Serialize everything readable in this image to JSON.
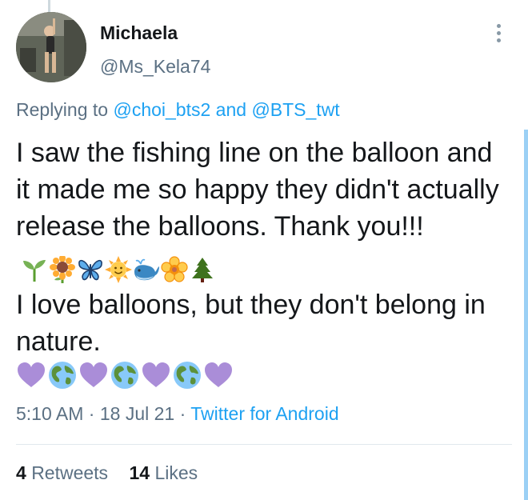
{
  "author": {
    "display_name": "Michaela",
    "handle": "@Ms_Kela74"
  },
  "reply": {
    "prefix": "Replying to",
    "user1": "@choi_bts2",
    "conjunction": "and",
    "user2": "@BTS_twt"
  },
  "tweet": {
    "text_part1": "I saw the fishing line on the balloon and it made me so happy they didn't actually release the balloons. Thank you!!!",
    "emojis": [
      "seedling-icon",
      "sunflower-icon",
      "butterfly-icon",
      "sun-face-icon",
      "whale-icon",
      "blossom-icon",
      "evergreen-tree-icon"
    ],
    "text_part2": "I love balloons, but they don't belong in nature.",
    "emoji_row": [
      "purple-heart-icon",
      "globe-icon",
      "purple-heart-icon",
      "globe-icon",
      "purple-heart-icon",
      "globe-icon",
      "purple-heart-icon"
    ]
  },
  "meta": {
    "time": "5:10 AM",
    "date": "18 Jul 21",
    "source": "Twitter for Android",
    "separator": "·"
  },
  "stats": {
    "retweets_count": "4",
    "retweets_label": "Retweets",
    "likes_count": "14",
    "likes_label": "Likes"
  },
  "colors": {
    "link": "#1da1f2",
    "secondary_text": "#5b7083",
    "primary_text": "#14171a"
  }
}
